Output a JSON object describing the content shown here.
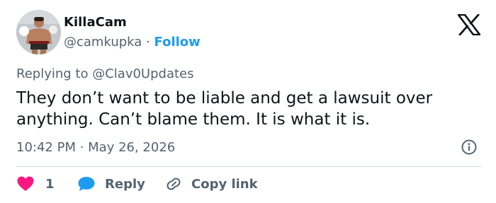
{
  "author": {
    "display_name": "KillaCam",
    "handle": "@camkupka",
    "separator": "·",
    "follow_label": "Follow"
  },
  "brand": {
    "icon": "x-logo-icon"
  },
  "reply_context": {
    "prefix": "Replying to",
    "mention": "@Clav0Updates"
  },
  "tweet": {
    "text": "They don’t want to be liable and get a lawsuit over anything. Can’t blame them. It is what it is.",
    "timestamp": "10:42 PM · May 26, 2026"
  },
  "actions": {
    "like_count": "1",
    "reply_label": "Reply",
    "copy_link_label": "Copy link"
  },
  "colors": {
    "accent": "#1d9bf0",
    "like": "#f91880",
    "secondary_text": "#536471",
    "primary_text": "#0f1419"
  }
}
